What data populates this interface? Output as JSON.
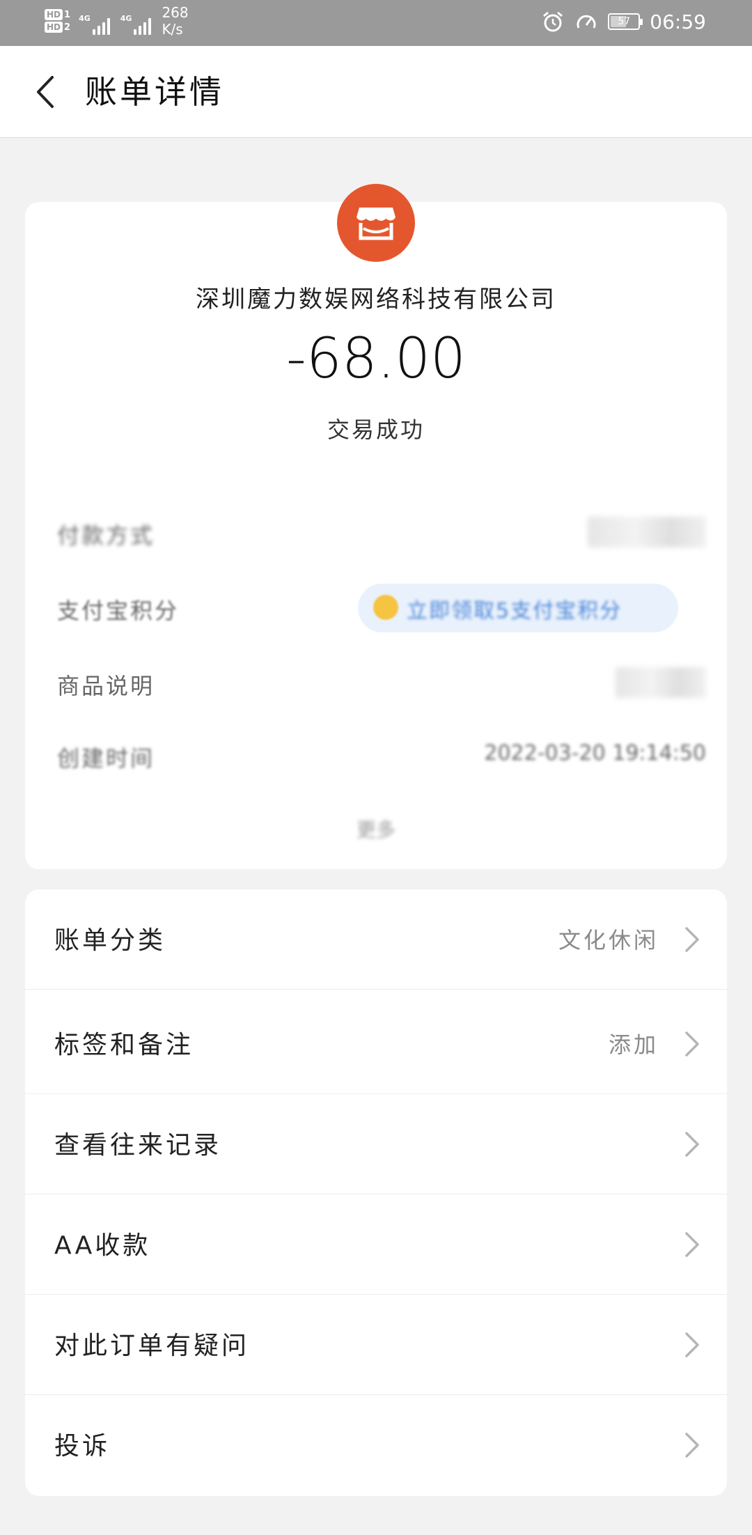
{
  "status_bar": {
    "hd1": "HD",
    "hd1_num": "1",
    "hd2": "HD",
    "hd2_num": "2",
    "sig1_tag": "4G",
    "sig2_tag": "4G",
    "speed_value": "268",
    "speed_unit": "K/s",
    "battery_level": "57",
    "battery_fraction": 0.57,
    "time": "06:59",
    "icons": [
      "alarm-icon",
      "data-saver-icon",
      "battery-icon"
    ]
  },
  "header": {
    "title": "账单详情",
    "back_icon": "chevron-left-icon"
  },
  "transaction": {
    "merchant_icon": "store-icon",
    "merchant_color": "#e4572e",
    "merchant_name": "深圳魔力数娱网络科技有限公司",
    "amount": "-68.00",
    "status": "交易成功"
  },
  "details": {
    "row1_label": "付款方式",
    "row2_label": "支付宝积分",
    "row2_promo": "立即领取5支付宝积分",
    "row3_label": "商品说明",
    "row4_label": "创建时间",
    "row4_value": "2022-03-20 19:14:50",
    "more_link": "更多"
  },
  "menu": {
    "items": [
      {
        "label": "账单分类",
        "value": "文化休闲"
      },
      {
        "label": "标签和备注",
        "value": "添加"
      },
      {
        "label": "查看往来记录",
        "value": ""
      },
      {
        "label": "AA收款",
        "value": ""
      },
      {
        "label": "对此订单有疑问",
        "value": ""
      },
      {
        "label": "投诉",
        "value": ""
      }
    ]
  }
}
